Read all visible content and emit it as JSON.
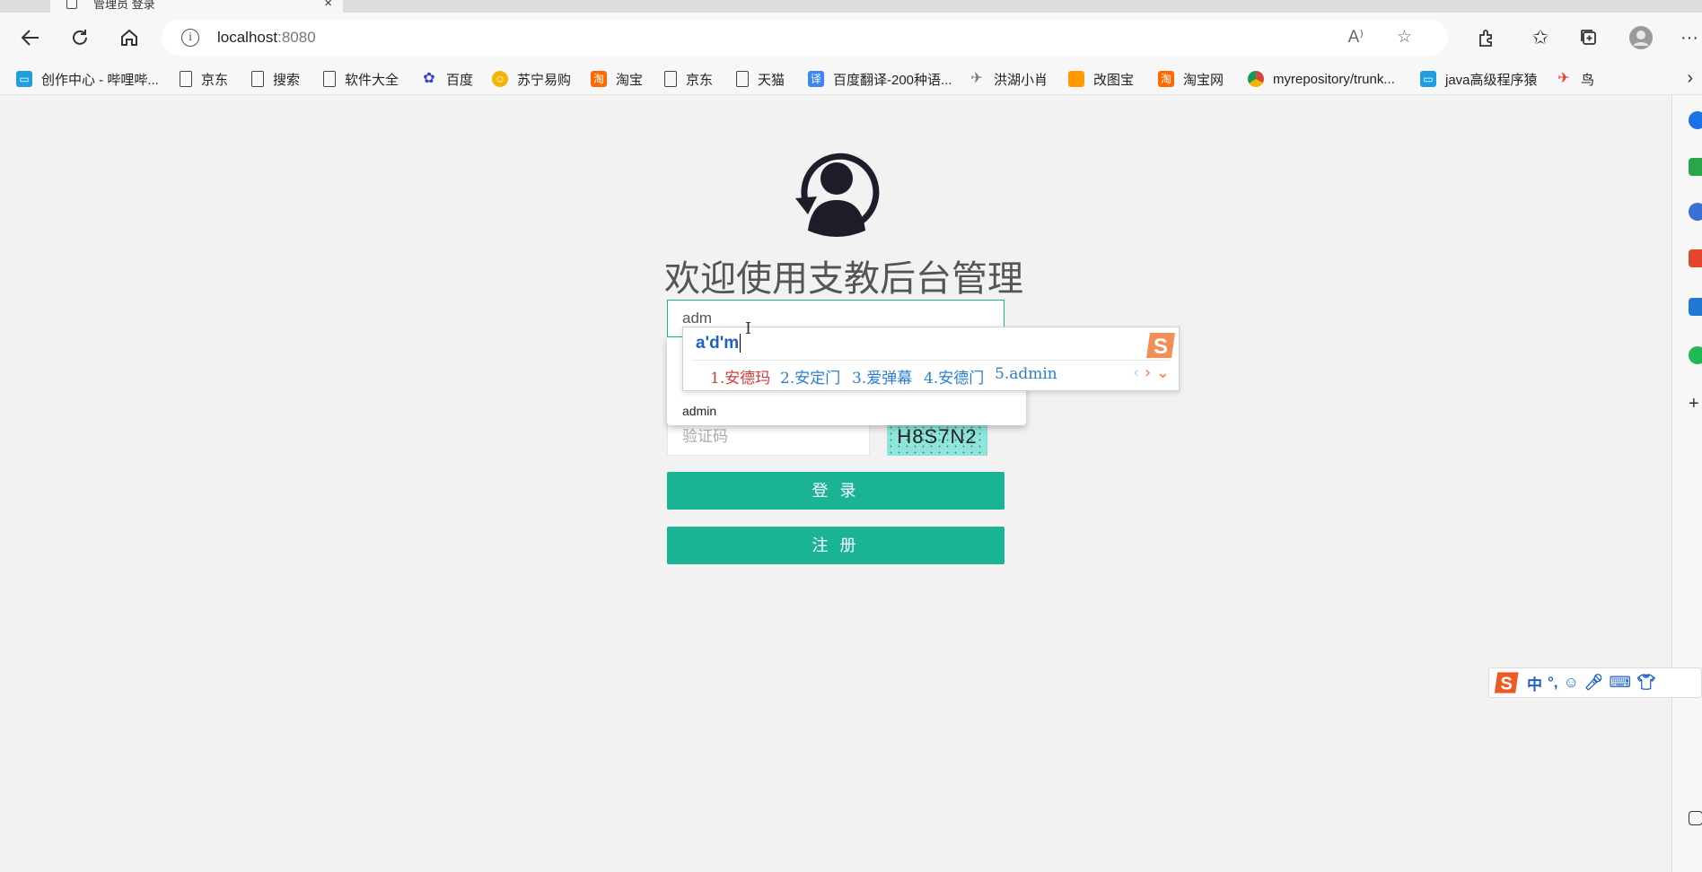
{
  "browser": {
    "tab_title": "管理员 登录",
    "tab_close": "×",
    "url_host": "localhost",
    "url_port": ":8080"
  },
  "bookmarks": [
    {
      "label": "创作中心 - 哔哩哔...",
      "icon": "bilibili-icon",
      "color": "#1ea0e0"
    },
    {
      "label": "京东",
      "icon": "page-icon"
    },
    {
      "label": "搜索",
      "icon": "page-icon"
    },
    {
      "label": "软件大全",
      "icon": "page-icon"
    },
    {
      "label": "百度",
      "icon": "baidu-paw-icon",
      "color": "#3145d1"
    },
    {
      "label": "苏宁易购",
      "icon": "suning-icon",
      "color": "#f5b400"
    },
    {
      "label": "淘宝",
      "icon": "taobao-icon",
      "color": "#ff6a00"
    },
    {
      "label": "京东",
      "icon": "page-icon"
    },
    {
      "label": "天猫",
      "icon": "page-icon"
    },
    {
      "label": "百度翻译-200种语...",
      "icon": "translate-icon",
      "color": "#3b86f0"
    },
    {
      "label": "洪湖小肖",
      "icon": "bird-icon",
      "color": "#777"
    },
    {
      "label": "改图宝",
      "icon": "gaitubao-icon",
      "color": "#ff9a00"
    },
    {
      "label": "淘宝网",
      "icon": "taobao-icon",
      "color": "#ff6a00"
    },
    {
      "label": "myrepository/trunk...",
      "icon": "chrome-icon",
      "color": "#db4437"
    },
    {
      "label": "java高级程序猿",
      "icon": "bilibili-icon",
      "color": "#1ea0e0"
    },
    {
      "label": "鸟",
      "icon": "bird-red-icon",
      "color": "#e03a2f"
    }
  ],
  "login": {
    "welcome": "欢迎使用支教后台管理",
    "username_value": "adm",
    "captcha_placeholder": "验证码",
    "captcha_text": "H8S7N2",
    "login_button": "登 录",
    "register_button": "注 册"
  },
  "autocomplete": {
    "suggestion": "admin"
  },
  "ime": {
    "pinyin": "a'd'm",
    "candidates": [
      "1.安德玛",
      "2.安定门",
      "3.爱弹幕",
      "4.安德门",
      "5.admin"
    ],
    "toolbar": [
      "中",
      "°,"
    ]
  },
  "colors": {
    "accent": "#1ab394",
    "ime_blue": "#1d62c1",
    "ime_red": "#d93a3a"
  }
}
